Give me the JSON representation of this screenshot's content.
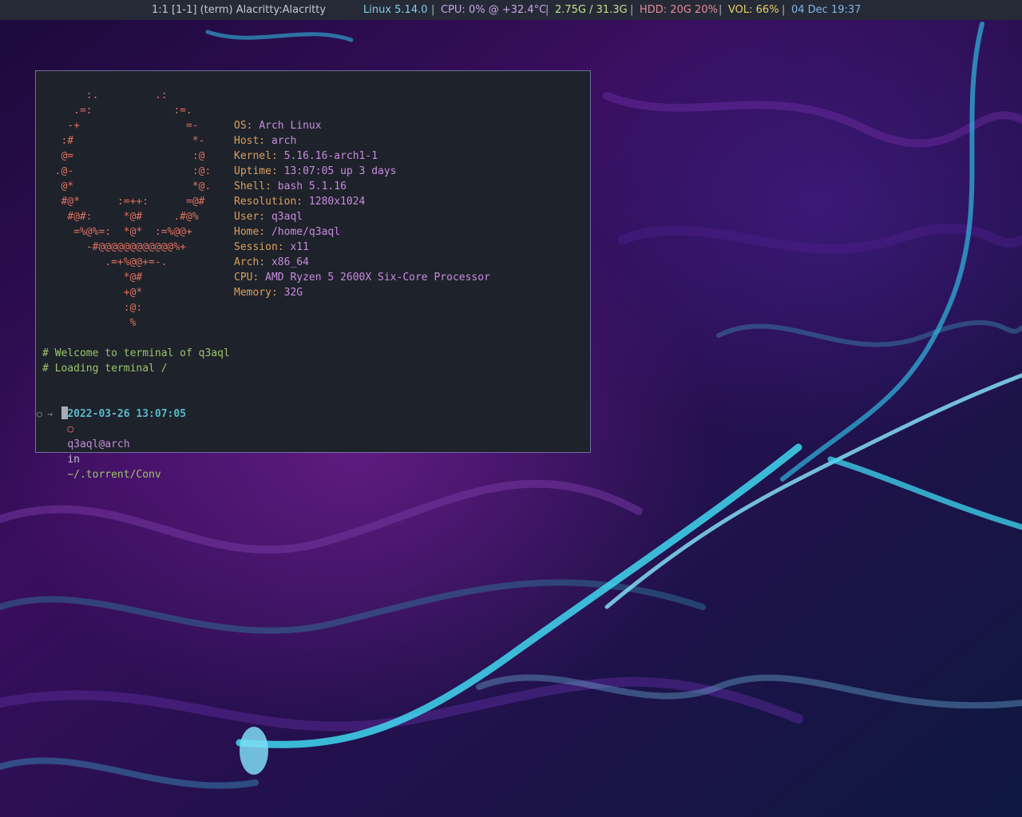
{
  "statusbar": {
    "workspace": "1:1 [1-1] (term) Alacritty:Alacritty",
    "kernel": "Linux 5.14.0",
    "cpu": "CPU: 0% @ +32.4°C",
    "mem": "2.75G / 31.3G",
    "hdd": "HDD: 20G 20%",
    "vol": "VOL: 66%",
    "datetime": "04 Dec 19:37",
    "separator": "|",
    "colors": {
      "kernel": "#7fd0e8",
      "cpu": "#c9a6e8",
      "mem": "#bfe08a",
      "hdd": "#e68a9a",
      "vol": "#e6cf6a",
      "datetime": "#7fb4e8"
    }
  },
  "terminal": {
    "art": [
      "       :.         .:",
      "     .=:             :=.",
      "    -+                 =-",
      "   :#                   *-",
      "   @=                   :@",
      "  .@-                   :@:",
      "   @*                   *@.",
      "   #@*      :=++:      =@#",
      "    #@#:     *@#     .#@%",
      "     =%@%=:  *@*  :=%@@+",
      "       -#@@@@@@@@@@@@%+",
      "          .=+%@@+=-.",
      "             *@#",
      "             +@*",
      "             :@:",
      "              %"
    ],
    "info": [
      {
        "key": "OS: ",
        "value": "Arch Linux"
      },
      {
        "key": "Host: ",
        "value": "arch"
      },
      {
        "key": "Kernel: ",
        "value": "5.16.16-arch1-1"
      },
      {
        "key": "Uptime: ",
        "value": "13:07:05 up 3 days"
      },
      {
        "key": "Shell: ",
        "value": "bash 5.1.16"
      },
      {
        "key": "Resolution: ",
        "value": "1280x1024"
      },
      {
        "key": "User: ",
        "value": "q3aql"
      },
      {
        "key": "Home: ",
        "value": "/home/q3aql"
      },
      {
        "key": "Session: ",
        "value": "x11"
      },
      {
        "key": "Arch: ",
        "value": "x86_64"
      },
      {
        "key": "CPU: ",
        "value": "AMD Ryzen 5 2600X Six-Core Processor"
      },
      {
        "key": "Memory: ",
        "value": "32G"
      }
    ],
    "welcome": "# Welcome to terminal of q3aql",
    "loading": "# Loading terminal /",
    "prompt": {
      "datetime": "2022-03-26 13:07:05",
      "circle": "○",
      "userhost": "q3aql@arch",
      "in": "in",
      "path": "~/.torrent/Conv",
      "input_prefix": "○ →"
    }
  }
}
